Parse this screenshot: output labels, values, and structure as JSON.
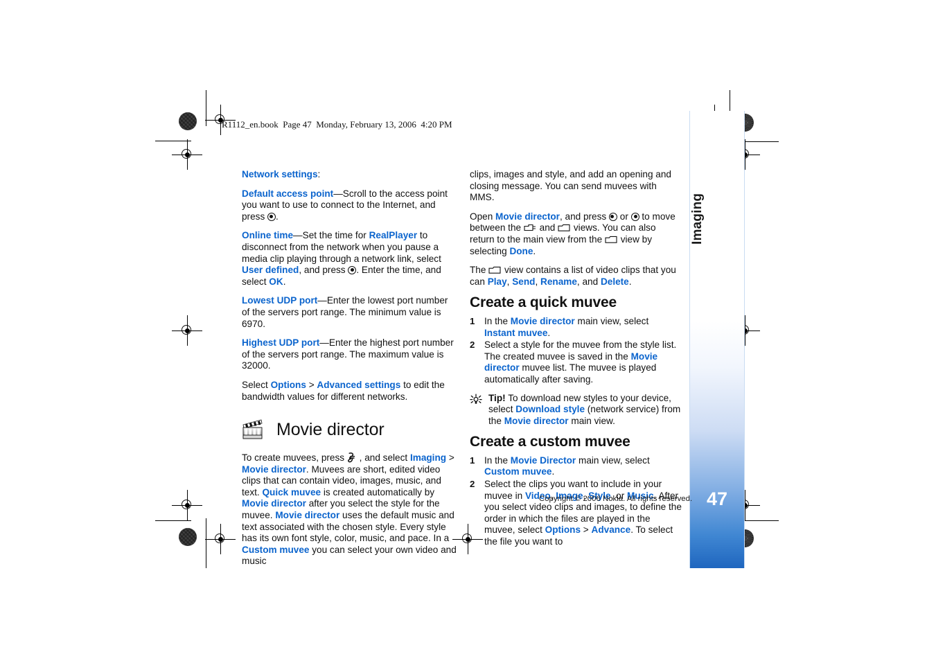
{
  "book_header": "R1112_en.book  Page 47  Monday, February 13, 2006  4:20 PM",
  "sidebar": {
    "chapter_label": "Imaging",
    "page_number": "47"
  },
  "footer": {
    "copyright": "Copyright © 2006 Nokia. All rights reserved."
  },
  "left_column": {
    "network_settings_label": "Network settings",
    "network_settings_colon": ":",
    "default_access_point": {
      "term": "Default access point",
      "text_a": "—Scroll to the access point you want to use to connect to the Internet, and press ",
      "text_b": "."
    },
    "online_time": {
      "term": "Online time",
      "text_a": "—Set the time for ",
      "link_realplayer": "RealPlayer",
      "text_b": " to disconnect from the network when you pause a media clip playing through a network link, select ",
      "link_user_defined": "User defined",
      "text_c": ", and press ",
      "text_d": ". Enter the time, and select ",
      "link_ok": "OK",
      "text_e": "."
    },
    "lowest_udp": {
      "term": "Lowest UDP port",
      "text": "—Enter the lowest port number of the servers port range. The minimum value is 6970."
    },
    "highest_udp": {
      "term": "Highest UDP port",
      "text": "—Enter the highest port number of the servers port range. The maximum value is 32000."
    },
    "bandwidth": {
      "text_a": "Select ",
      "link_options": "Options",
      "gt": " > ",
      "link_advanced": "Advanced settings",
      "text_b": " to edit the bandwidth values for different networks."
    },
    "chapter_title": "Movie director",
    "intro": {
      "text_a": "To create muvees, press ",
      "text_b": " , and select ",
      "link_imaging": "Imaging",
      "gt": " > ",
      "link_movie_director": "Movie director",
      "text_c": ". Muvees are short, edited video clips that can contain video, images, music, and text. ",
      "link_quick_muvee": "Quick muvee",
      "text_d": " is created automatically by ",
      "link_movie_director2": "Movie director",
      "text_e": " after you select the style for the muvee. ",
      "link_movie_director3": "Movie director",
      "text_f": " uses the default music and text associated with the chosen style. Every style has its own font style, color, music, and pace. In a ",
      "link_custom_muvee": "Custom muvee",
      "text_g": " you can select your own video and music"
    }
  },
  "right_column": {
    "continuation": "clips, images and style, and add an opening and closing message. You can send muvees with MMS.",
    "open_para": {
      "text_a": "Open ",
      "link_movie_director": "Movie director",
      "text_b": ", and press ",
      "text_c": " or ",
      "text_d": " to move between the ",
      "text_e": " and ",
      "text_f": " views. You can also return to the main view from the ",
      "text_g": " view by selecting ",
      "link_done": "Done",
      "text_h": "."
    },
    "view_para": {
      "text_a": "The ",
      "text_b": " view contains a list of video clips that you can ",
      "link_play": "Play",
      "sep1": ", ",
      "link_send": "Send",
      "sep2": ", ",
      "link_rename": "Rename",
      "sep3": ", and ",
      "link_delete": "Delete",
      "text_c": "."
    },
    "quick_muvee": {
      "heading": "Create a quick muvee",
      "step1": {
        "num": "1",
        "text_a": "In the ",
        "link_movie_director": "Movie director",
        "text_b": " main view, select ",
        "link_instant_muvee": "Instant muvee",
        "text_c": "."
      },
      "step2": {
        "num": "2",
        "text_a": "Select a style for the muvee from the style list. The created muvee is saved in the ",
        "link_movie_director": "Movie director",
        "text_b": " muvee list. The muvee is played automatically after saving."
      }
    },
    "tip": {
      "label": "Tip!",
      "text_a": " To download new styles to your device, select ",
      "link_download_style": "Download style",
      "text_b": " (network service) from the ",
      "link_movie_director": "Movie director",
      "text_c": " main view."
    },
    "custom_muvee": {
      "heading": "Create a custom muvee",
      "step1": {
        "num": "1",
        "text_a": "In the ",
        "link_movie_director": "Movie Director",
        "text_b": " main view, select ",
        "link_custom_muvee": "Custom muvee",
        "text_c": "."
      },
      "step2": {
        "num": "2",
        "text_a": "Select the clips you want to include in your muvee in ",
        "link_video": "Video",
        "sep1": ", ",
        "link_image": "Image",
        "sep2": ", ",
        "link_style": "Style",
        "sep3": ", or ",
        "link_music": "Music",
        "text_b": ". After you select video clips and images, to define the order in which the files are played in the muvee, select ",
        "link_options": "Options",
        "gt": " > ",
        "link_advance": "Advance",
        "text_c": ". To select the file you want to"
      }
    }
  },
  "colors": {
    "link_blue": "#0b64cd",
    "sidebar_blue": "#1f66bf",
    "text_black": "#111111"
  },
  "icons": {
    "movie_director": "clapperboard-icon",
    "scroll_key": "scroll-key-icon",
    "menu_key": "menu-key-icon",
    "tab_view": "tab-view-icon",
    "folder_view": "folder-view-icon",
    "tip": "tip-lightbulb-icon"
  }
}
